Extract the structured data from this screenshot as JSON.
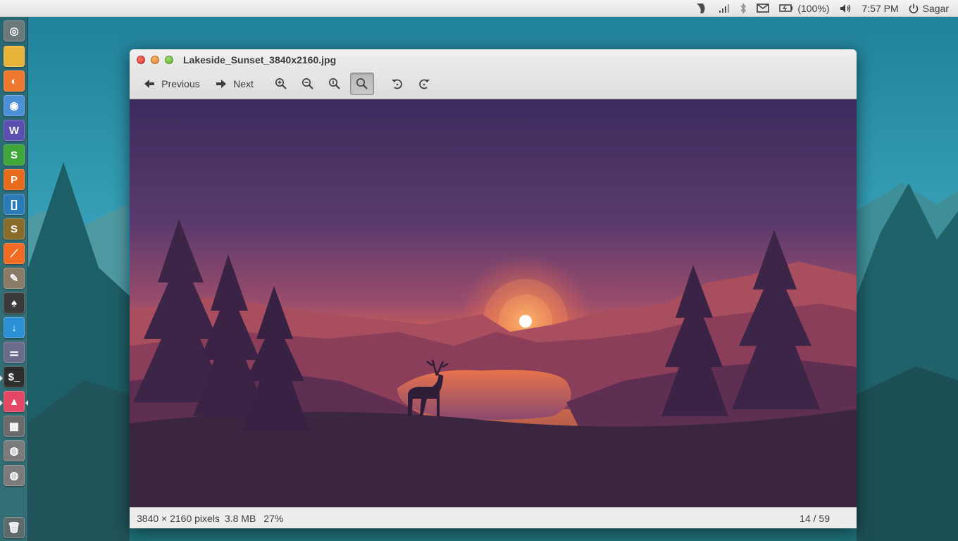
{
  "top_panel": {
    "battery_text": "(100%)",
    "clock": "7:57 PM",
    "user": "Sagar"
  },
  "launcher": {
    "items": [
      {
        "name": "ubuntu-dash-icon",
        "glyph": "◎",
        "color": "#6c7a7b"
      },
      {
        "name": "files-icon",
        "glyph": "",
        "color": "#e9b43a"
      },
      {
        "name": "firefox-icon",
        "glyph": "◐",
        "color": "#f0782e"
      },
      {
        "name": "chrome-icon",
        "glyph": "◉",
        "color": "#4a8fd8"
      },
      {
        "name": "wps-writer-icon",
        "glyph": "W",
        "color": "#5a4fb0"
      },
      {
        "name": "wps-spreadsheets-icon",
        "glyph": "S",
        "color": "#3fa63a"
      },
      {
        "name": "wps-presentation-icon",
        "glyph": "P",
        "color": "#e86a1b"
      },
      {
        "name": "brackets-icon",
        "glyph": "[]",
        "color": "#2b7bb9"
      },
      {
        "name": "sublime-text-icon",
        "glyph": "S",
        "color": "#8a6c2a"
      },
      {
        "name": "postman-icon",
        "glyph": "⟋",
        "color": "#f26b22"
      },
      {
        "name": "gimp-icon",
        "glyph": "✎",
        "color": "#8b7b66"
      },
      {
        "name": "inkscape-icon",
        "glyph": "♠",
        "color": "#3a3a3a"
      },
      {
        "name": "download-manager-icon",
        "glyph": "↓",
        "color": "#2b8fd6"
      },
      {
        "name": "settings-toggle-icon",
        "glyph": "⚌",
        "color": "#6a6a8a"
      },
      {
        "name": "terminal-icon",
        "glyph": "$_",
        "color": "#2e2e2e"
      },
      {
        "name": "image-viewer-icon",
        "glyph": "▲",
        "color": "#e54663"
      },
      {
        "name": "workspace-switcher-icon",
        "glyph": "▦",
        "color": "#6b6b6b"
      },
      {
        "name": "disk-drive-icon",
        "glyph": "◍",
        "color": "#7b7b7b"
      },
      {
        "name": "disk-drive-2-icon",
        "glyph": "◍",
        "color": "#7b7b7b"
      },
      {
        "name": "trash-icon",
        "glyph": "🗑",
        "color": "#5e6a6c"
      }
    ]
  },
  "window": {
    "title": "Lakeside_Sunset_3840x2160.jpg",
    "toolbar": {
      "previous_label": "Previous",
      "next_label": "Next"
    },
    "status": {
      "dimensions": "3840 × 2160 pixels",
      "size": "3.8 MB",
      "zoom": "27%",
      "position": "14 / 59"
    }
  },
  "colors": {
    "sky_top": "#3b2b5c",
    "sky_mid": "#8a4a73",
    "horizon": "#f07a4a",
    "sun": "#ffffff",
    "foreground": "#3a2640"
  }
}
